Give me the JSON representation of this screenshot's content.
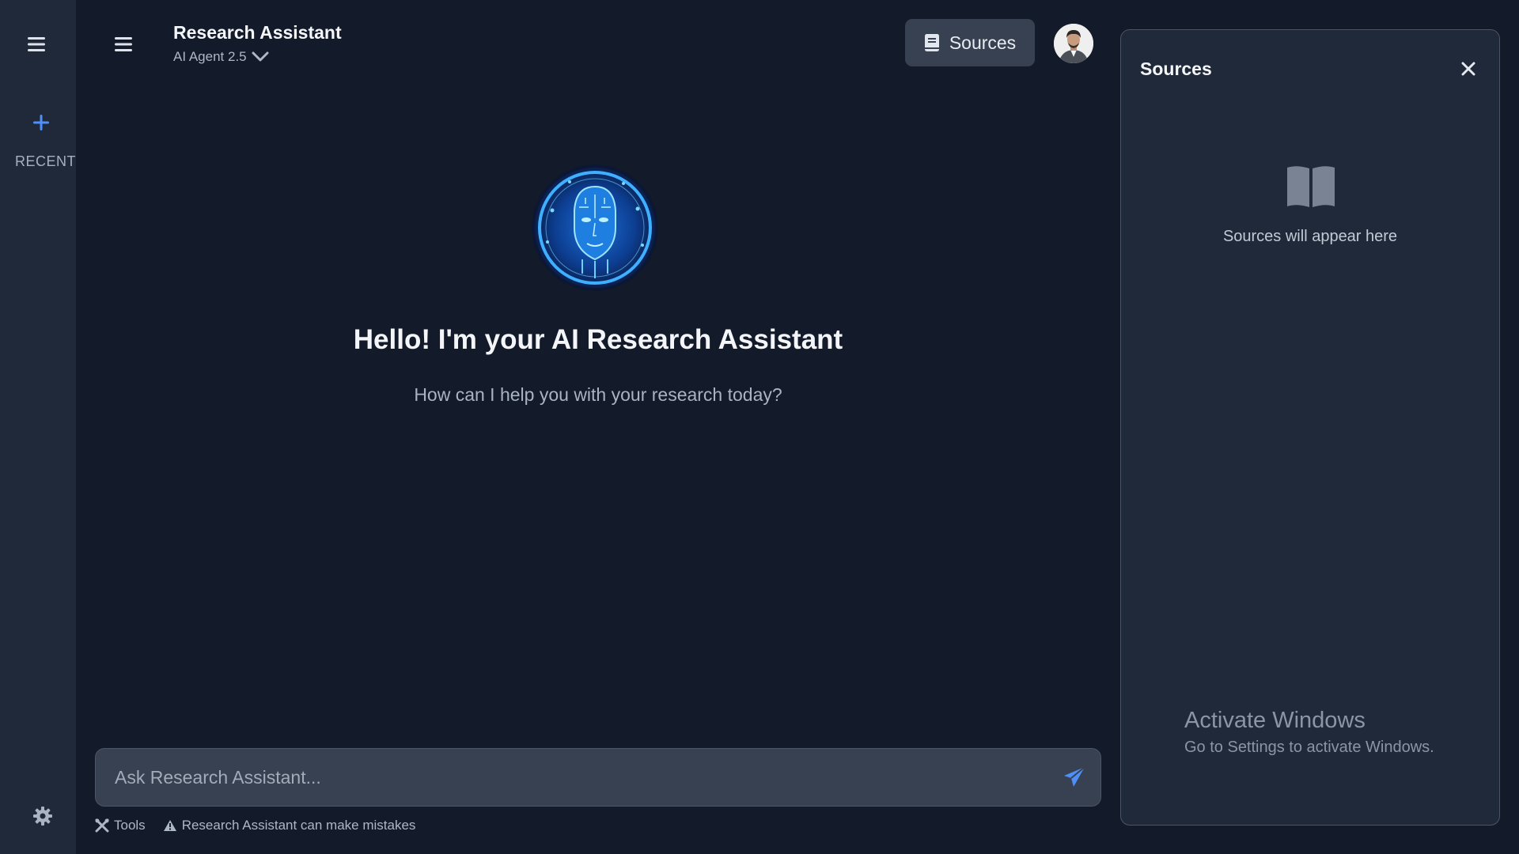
{
  "sidebar": {
    "recent_label": "RECENT"
  },
  "header": {
    "title": "Research Assistant",
    "model_label": "AI Agent 2.5",
    "sources_button_label": "Sources"
  },
  "hero": {
    "title": "Hello! I'm your AI Research Assistant",
    "subtitle": "How can I help you with your research today?"
  },
  "composer": {
    "placeholder": "Ask Research Assistant...",
    "value": ""
  },
  "footer": {
    "tools_label": "Tools",
    "disclaimer": "Research Assistant can make mistakes"
  },
  "sources_panel": {
    "title": "Sources",
    "empty_text": "Sources will appear here"
  },
  "watermark": {
    "title": "Activate Windows",
    "subtitle": "Go to Settings to activate Windows."
  },
  "icons": {
    "rail_menu": "hamburger-icon",
    "new_chat": "plus-icon",
    "settings": "gear-icon",
    "header_menu": "hamburger-icon",
    "model_dropdown": "chevron-down-icon",
    "sources": "book-icon",
    "send": "paper-plane-icon",
    "tools": "tools-icon",
    "warning": "warning-icon",
    "close": "close-icon",
    "empty_sources": "open-book-icon"
  },
  "colors": {
    "background": "#131a2a",
    "sidebar": "#1f2939",
    "accent": "#4f8ff7",
    "input": "#374151"
  }
}
